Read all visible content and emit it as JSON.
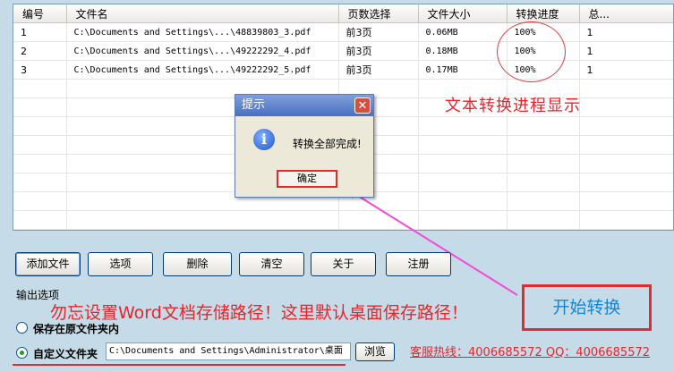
{
  "table": {
    "headers": [
      "编号",
      "文件名",
      "页数选择",
      "文件大小",
      "转换进度",
      "总..."
    ],
    "rows": [
      [
        "1",
        "C:\\Documents and Settings\\...\\48839803_3.pdf",
        "前3页",
        "0.06MB",
        "100%",
        "1"
      ],
      [
        "2",
        "C:\\Documents and Settings\\...\\49222292_4.pdf",
        "前3页",
        "0.18MB",
        "100%",
        "1"
      ],
      [
        "3",
        "C:\\Documents and Settings\\...\\49222292_5.pdf",
        "前3页",
        "0.17MB",
        "100%",
        "1"
      ]
    ]
  },
  "annotations": {
    "progress_note": "文本转换进程显示",
    "warning": "勿忘设置Word文档存储路径！这里默认桌面保存路径！"
  },
  "dialog": {
    "title": "提示",
    "close_glyph": "✕",
    "icon_glyph": "i",
    "message": "转换全部完成!",
    "ok_label": "确定"
  },
  "toolbar": {
    "add_file": "添加文件",
    "options": "选项",
    "delete": "删除",
    "clear": "清空",
    "about": "关于",
    "register": "注册",
    "start": "开始转换"
  },
  "output": {
    "section_label": "输出选项",
    "save_original": "保存在原文件夹内",
    "custom_folder": "自定义文件夹",
    "path_value": "C:\\Documents and Settings\\Administrator\\桌面",
    "browse": "浏览",
    "selected": "custom_folder"
  },
  "hotline": "客服热线：4006685572 QQ：4006685572",
  "colors": {
    "background": "#c6dbe8",
    "annotation_red": "#e6252b",
    "arrow_pink": "#f24bd8",
    "start_blue": "#1784d6"
  },
  "icons": {
    "dialog_icon": "info-icon",
    "close_icon": "close-icon"
  }
}
